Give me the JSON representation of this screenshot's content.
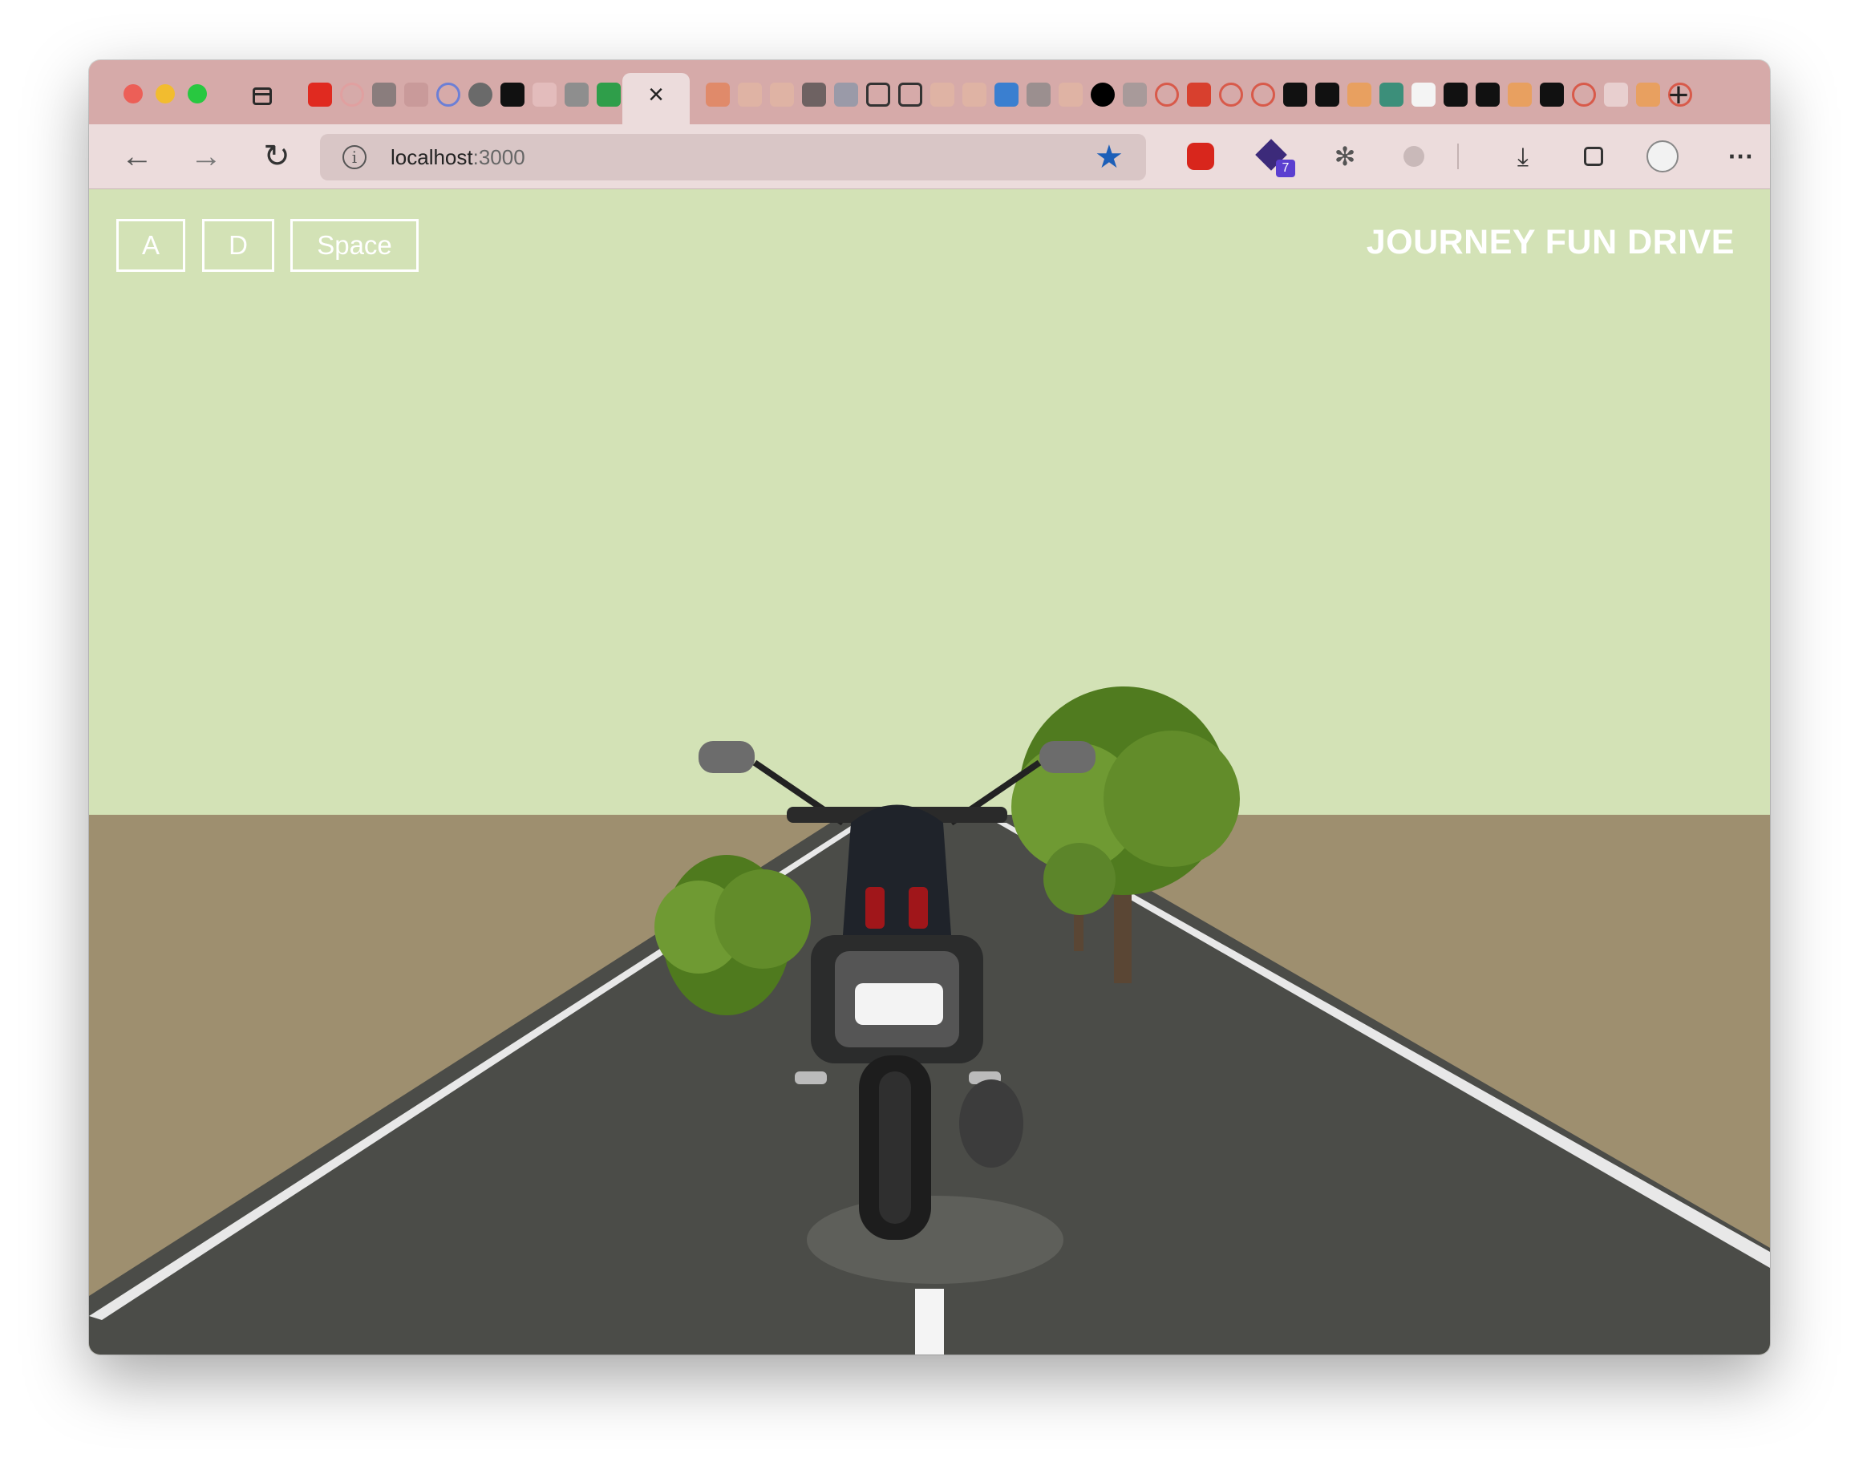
{
  "browser": {
    "url_host": "localhost",
    "url_port": ":3000",
    "tab_close_glyph": "×",
    "new_tab_glyph": "+",
    "nav": {
      "back": "←",
      "forward": "→",
      "reload": "↻"
    },
    "extension_badge": "7",
    "more_glyph": "···"
  },
  "game": {
    "title": "JOURNEY FUN DRIVE",
    "controls": [
      {
        "label": "A"
      },
      {
        "label": "D"
      },
      {
        "label": "Space"
      }
    ]
  },
  "colors": {
    "sky": "#d3e2b6",
    "ground": "#9e8f6f",
    "road": "#4a4b47",
    "tabbar": "#d6aaa9",
    "toolbar": "#ecdcdc"
  }
}
